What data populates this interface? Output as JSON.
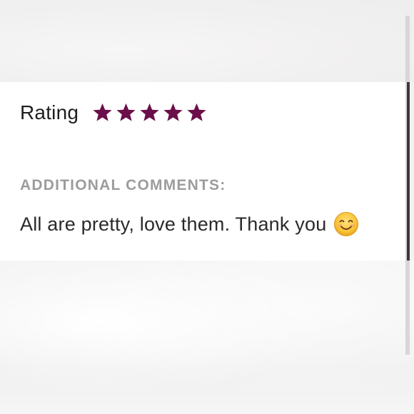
{
  "review": {
    "rating_label": "Rating",
    "rating_value": 5,
    "rating_max": 5,
    "comments_heading": "ADDITIONAL COMMENTS:",
    "comment_text": "All are pretty, love them. Thank you"
  },
  "icons": {
    "star": "star-icon",
    "emoji": "smiling-face-icon"
  },
  "colors": {
    "star": "#6b0f4a",
    "heading_gray": "#9c9c9c",
    "text": "#1e1e1e"
  }
}
